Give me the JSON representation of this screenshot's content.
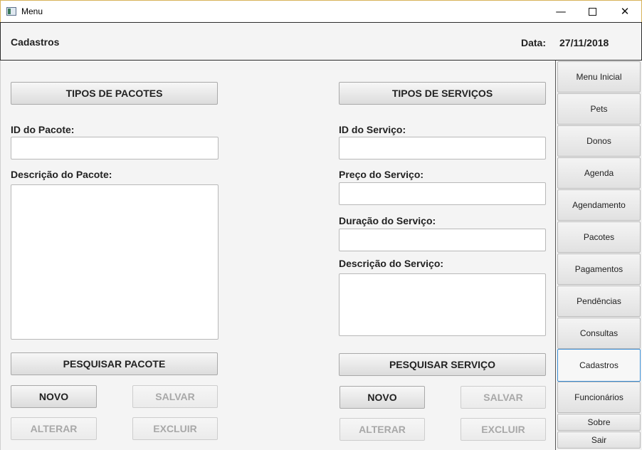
{
  "window": {
    "title": "Menu",
    "minimize_glyph": "—",
    "close_glyph": "✕"
  },
  "header": {
    "title": "Cadastros",
    "date_label": "Data:",
    "date_value": "27/11/2018"
  },
  "packages": {
    "section_button": "TIPOS DE PACOTES",
    "id_label": "ID do Pacote:",
    "id_value": "",
    "description_label": "Descrição do Pacote:",
    "description_value": "",
    "search_button": "PESQUISAR PACOTE",
    "new_button": "NOVO",
    "save_button": "SALVAR",
    "edit_button": "ALTERAR",
    "delete_button": "EXCLUIR"
  },
  "services": {
    "section_button": "TIPOS DE SERVIÇOS",
    "id_label": "ID do Serviço:",
    "id_value": "",
    "price_label": "Preço do Serviço:",
    "price_value": "",
    "duration_label": "Duração do Serviço:",
    "duration_value": "",
    "description_label": "Descrição do Serviço:",
    "description_value": "",
    "search_button": "PESQUISAR SERVIÇO",
    "new_button": "NOVO",
    "save_button": "SALVAR",
    "edit_button": "ALTERAR",
    "delete_button": "EXCLUIR"
  },
  "sidebar": {
    "items": [
      {
        "label": "Menu Inicial"
      },
      {
        "label": "Pets"
      },
      {
        "label": "Donos"
      },
      {
        "label": "Agenda"
      },
      {
        "label": "Agendamento"
      },
      {
        "label": "Pacotes"
      },
      {
        "label": "Pagamentos"
      },
      {
        "label": "Pendências"
      },
      {
        "label": "Consultas"
      },
      {
        "label": "Cadastros"
      },
      {
        "label": "Funcionários"
      },
      {
        "label": "Sobre"
      },
      {
        "label": "Sair"
      }
    ],
    "active_item": "Cadastros"
  },
  "colors": {
    "active_border": "#3b8fd6",
    "disabled_text": "#a8a8a8"
  }
}
